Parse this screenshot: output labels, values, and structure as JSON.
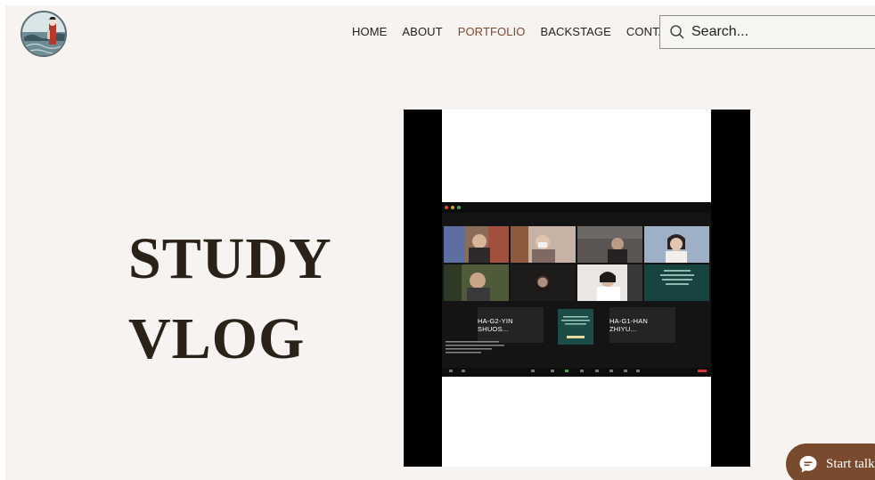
{
  "nav": {
    "items": [
      {
        "label": "HOME",
        "active": false
      },
      {
        "label": "ABOUT",
        "active": false
      },
      {
        "label": "PORTFOLIO",
        "active": true
      },
      {
        "label": "BACKSTAGE",
        "active": false
      },
      {
        "label": "CONTACT",
        "active": false
      }
    ]
  },
  "search": {
    "placeholder": "Search...",
    "icon": "search-icon"
  },
  "hero": {
    "line1": "STUDY",
    "line2": "VLOG"
  },
  "video": {
    "participants": [
      {
        "name": "HA-G2-YIN SHUOS..."
      },
      {
        "name": "HA-G1-HAN ZHIYU..."
      }
    ]
  },
  "chat_widget": {
    "label": "Start talking",
    "icon": "chat-bubble-icon"
  },
  "colors": {
    "accent": "#7a4a2e",
    "background": "#f6f3f0",
    "title": "#2a2118"
  }
}
